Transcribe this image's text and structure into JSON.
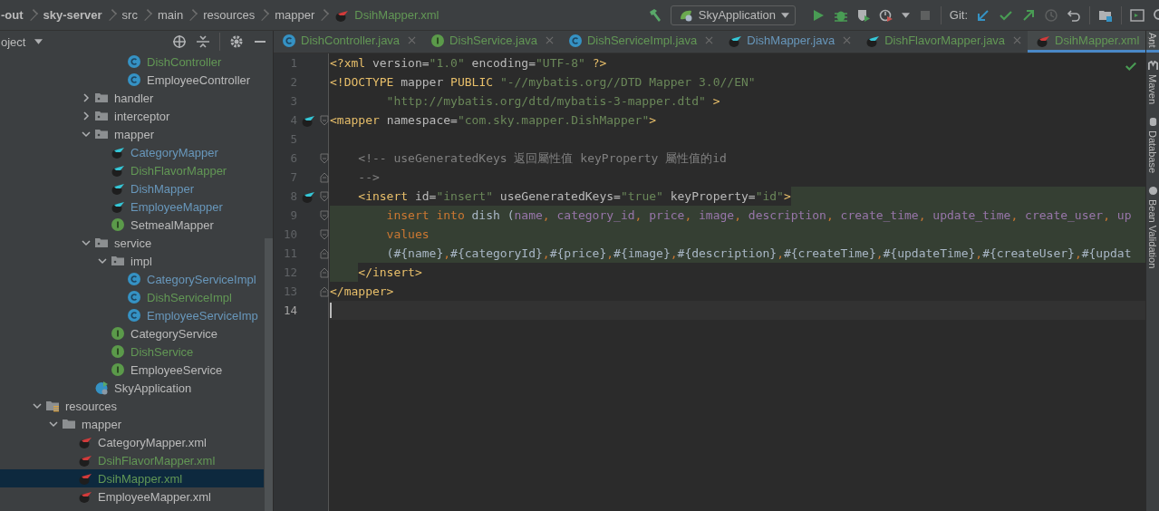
{
  "breadcrumbs": [
    {
      "label": "-out",
      "kind": "module"
    },
    {
      "label": "sky-server",
      "kind": "module"
    },
    {
      "label": "src",
      "kind": "folder"
    },
    {
      "label": "main",
      "kind": "folder"
    },
    {
      "label": "resources",
      "kind": "folder"
    },
    {
      "label": "mapper",
      "kind": "folder"
    },
    {
      "label": "DsihMapper.xml",
      "kind": "file",
      "color": "#629755"
    }
  ],
  "toolbar": {
    "run_config": "SkyApplication",
    "vcs_label": "Git:"
  },
  "project_panel": {
    "title": "oject",
    "tree": [
      {
        "children": [
          {
            "children": [
              {
                "children": [
                  {
                    "children": [
                      {
                        "children": [
                          {
                            "label": "DishController",
                            "kind": "class",
                            "color": "#629755",
                            "selected": false
                          },
                          {
                            "label": "EmployeeController",
                            "kind": "class",
                            "selected": false
                          }
                        ]
                      }
                    ]
                  },
                  {
                    "label": "handler",
                    "kind": "package",
                    "expanded": false,
                    "selected": false
                  },
                  {
                    "label": "interceptor",
                    "kind": "package",
                    "expanded": false,
                    "selected": false
                  },
                  {
                    "label": "mapper",
                    "kind": "package",
                    "expanded": true,
                    "selected": false,
                    "children": [
                      {
                        "label": "CategoryMapper",
                        "kind": "mapper-java",
                        "color": "#6897bb",
                        "selected": false
                      },
                      {
                        "label": "DishFlavorMapper",
                        "kind": "mapper-java",
                        "color": "#629755",
                        "selected": false
                      },
                      {
                        "label": "DishMapper",
                        "kind": "mapper-java",
                        "color": "#6897bb",
                        "selected": false
                      },
                      {
                        "label": "EmployeeMapper",
                        "kind": "mapper-java",
                        "color": "#6897bb",
                        "selected": false
                      },
                      {
                        "label": "SetmealMapper",
                        "kind": "interface",
                        "selected": false
                      }
                    ]
                  },
                  {
                    "label": "service",
                    "kind": "package",
                    "expanded": true,
                    "selected": false,
                    "children": [
                      {
                        "label": "impl",
                        "kind": "package",
                        "expanded": true,
                        "selected": false,
                        "children": [
                          {
                            "label": "CategoryServiceImpl",
                            "kind": "class",
                            "color": "#6897bb",
                            "selected": false
                          },
                          {
                            "label": "DishServiceImpl",
                            "kind": "class",
                            "color": "#629755",
                            "selected": false
                          },
                          {
                            "label": "EmployeeServiceImp",
                            "kind": "class",
                            "color": "#6897bb",
                            "selected": false
                          }
                        ]
                      },
                      {
                        "label": "CategoryService",
                        "kind": "interface",
                        "selected": false
                      },
                      {
                        "label": "DishService",
                        "kind": "interface",
                        "color": "#629755",
                        "selected": false
                      },
                      {
                        "label": "EmployeeService",
                        "kind": "interface",
                        "selected": false
                      }
                    ]
                  },
                  {
                    "label": "SkyApplication",
                    "kind": "app",
                    "selected": false
                  }
                ]
              }
            ]
          }
        ]
      },
      {
        "label": "resources",
        "kind": "resources",
        "expanded": true,
        "selected": false,
        "children": [
          {
            "label": "mapper",
            "kind": "directory",
            "expanded": true,
            "selected": false,
            "children": [
              {
                "label": "CategoryMapper.xml",
                "kind": "mapper-xml",
                "selected": false
              },
              {
                "label": "DsihFlavorMapper.xml",
                "kind": "mapper-xml",
                "color": "#629755",
                "selected": false
              },
              {
                "label": "DsihMapper.xml",
                "kind": "mapper-xml",
                "color": "#629755",
                "selected": true
              },
              {
                "label": "EmployeeMapper.xml",
                "kind": "mapper-xml",
                "selected": false
              }
            ]
          }
        ]
      }
    ]
  },
  "editor_tabs": [
    {
      "label": "DishController.java",
      "kind": "class",
      "color": "#629755",
      "selected": false
    },
    {
      "label": "DishService.java",
      "kind": "interface",
      "color": "#629755",
      "selected": false
    },
    {
      "label": "DishServiceImpl.java",
      "kind": "class",
      "color": "#629755",
      "selected": false
    },
    {
      "label": "DishMapper.java",
      "kind": "mapper-java",
      "color": "#6897bb",
      "selected": false
    },
    {
      "label": "DishFlavorMapper.java",
      "kind": "mapper-java",
      "color": "#629755",
      "selected": false
    },
    {
      "label": "DsihMapper.xml",
      "kind": "mapper-xml",
      "color": "#629755",
      "selected": true
    }
  ],
  "editor": {
    "lines": [
      {
        "number": "1",
        "segments": [
          {
            "text": "<?xml ",
            "kind": "tag"
          },
          {
            "text": "version=",
            "kind": "attr"
          },
          {
            "text": "\"1.0\"",
            "kind": "string"
          },
          {
            "text": " encoding=",
            "kind": "attr"
          },
          {
            "text": "\"UTF-8\"",
            "kind": "string"
          },
          {
            "text": " ?>",
            "kind": "tag"
          }
        ]
      },
      {
        "number": "2",
        "segments": [
          {
            "text": "<!DOCTYPE ",
            "kind": "tag"
          },
          {
            "text": "mapper ",
            "kind": "attr"
          },
          {
            "text": "PUBLIC ",
            "kind": "tag"
          },
          {
            "text": "\"-//mybatis.org//DTD Mapper 3.0//EN\"",
            "kind": "string"
          }
        ]
      },
      {
        "number": "3",
        "segments": [
          {
            "text": "        \"http://mybatis.org/dtd/mybatis-3-mapper.dtd\"",
            "kind": "string"
          },
          {
            "text": " >",
            "kind": "tag"
          }
        ]
      },
      {
        "number": "4",
        "mapper_icon": true,
        "fold_start": true,
        "segments": [
          {
            "text": "<mapper ",
            "kind": "tag"
          },
          {
            "text": "namespace=",
            "kind": "attr"
          },
          {
            "text": "\"com.sky.mapper.DishMapper\"",
            "kind": "string"
          },
          {
            "text": ">",
            "kind": "tag"
          }
        ]
      },
      {
        "number": "5"
      },
      {
        "number": "6",
        "fold_start": true,
        "segments": [
          {
            "text": "    <!-- useGeneratedKeys 返回屬性值 keyProperty 屬性值的id",
            "kind": "comment"
          }
        ]
      },
      {
        "number": "7",
        "fold_end": true,
        "segments": [
          {
            "text": "    -->",
            "kind": "comment"
          }
        ]
      },
      {
        "number": "8",
        "mapper_icon": true,
        "fold_start": true,
        "highlighted": true,
        "segments": [
          {
            "text": "    <insert ",
            "kind": "tag"
          },
          {
            "text": "id=",
            "kind": "attr"
          },
          {
            "text": "\"insert\"",
            "kind": "string"
          },
          {
            "text": " useGeneratedKeys=",
            "kind": "attr"
          },
          {
            "text": "\"true\"",
            "kind": "string"
          },
          {
            "text": " keyProperty=",
            "kind": "attr"
          },
          {
            "text": "\"id\"",
            "kind": "string"
          },
          {
            "text": ">",
            "kind": "tag"
          }
        ]
      },
      {
        "number": "9",
        "fold_start": true,
        "highlighted": true,
        "segments": [
          {
            "text": "        insert into ",
            "kind": "keyword"
          },
          {
            "text": "dish (",
            "kind": "plain"
          },
          {
            "text": "name",
            "kind": "column"
          },
          {
            "text": ", ",
            "kind": "punct"
          },
          {
            "text": "category_id",
            "kind": "column"
          },
          {
            "text": ", ",
            "kind": "punct"
          },
          {
            "text": "price",
            "kind": "column"
          },
          {
            "text": ", ",
            "kind": "punct"
          },
          {
            "text": "image",
            "kind": "column"
          },
          {
            "text": ", ",
            "kind": "punct"
          },
          {
            "text": "description",
            "kind": "column"
          },
          {
            "text": ", ",
            "kind": "punct"
          },
          {
            "text": "create_time",
            "kind": "column"
          },
          {
            "text": ", ",
            "kind": "punct"
          },
          {
            "text": "update_time",
            "kind": "column"
          },
          {
            "text": ", ",
            "kind": "punct"
          },
          {
            "text": "create_user",
            "kind": "column"
          },
          {
            "text": ", ",
            "kind": "punct"
          },
          {
            "text": "up",
            "kind": "column"
          }
        ]
      },
      {
        "number": "10",
        "fold_start": true,
        "highlighted": true,
        "segments": [
          {
            "text": "        values",
            "kind": "keyword"
          }
        ]
      },
      {
        "number": "11",
        "fold_end": true,
        "highlighted": true,
        "segments": [
          {
            "text": "        (",
            "kind": "plain"
          },
          {
            "text": "#{name}",
            "kind": "plain"
          },
          {
            "text": ",",
            "kind": "punct"
          },
          {
            "text": "#{categoryId}",
            "kind": "plain"
          },
          {
            "text": ",",
            "kind": "punct"
          },
          {
            "text": "#{price}",
            "kind": "plain"
          },
          {
            "text": ",",
            "kind": "punct"
          },
          {
            "text": "#{image}",
            "kind": "plain"
          },
          {
            "text": ",",
            "kind": "punct"
          },
          {
            "text": "#{description}",
            "kind": "plain"
          },
          {
            "text": ",",
            "kind": "punct"
          },
          {
            "text": "#{createTime}",
            "kind": "plain"
          },
          {
            "text": ",",
            "kind": "punct"
          },
          {
            "text": "#{updateTime}",
            "kind": "plain"
          },
          {
            "text": ",",
            "kind": "punct"
          },
          {
            "text": "#{createUser}",
            "kind": "plain"
          },
          {
            "text": ",",
            "kind": "punct"
          },
          {
            "text": "#{updat",
            "kind": "plain"
          }
        ]
      },
      {
        "number": "12",
        "fold_end": true,
        "highlighted": true,
        "segments": [
          {
            "text": "    </insert>",
            "kind": "tag"
          }
        ]
      },
      {
        "number": "13",
        "fold_end": true,
        "segments": [
          {
            "text": "</mapper>",
            "kind": "tag"
          }
        ]
      },
      {
        "number": "14",
        "current": true
      }
    ]
  },
  "side_tools": [
    {
      "label": "Ant",
      "kind": "ant"
    },
    {
      "label": "Maven",
      "kind": "maven"
    },
    {
      "label": "Database",
      "kind": "database"
    },
    {
      "label": "Bean Validation",
      "kind": "bean"
    }
  ]
}
